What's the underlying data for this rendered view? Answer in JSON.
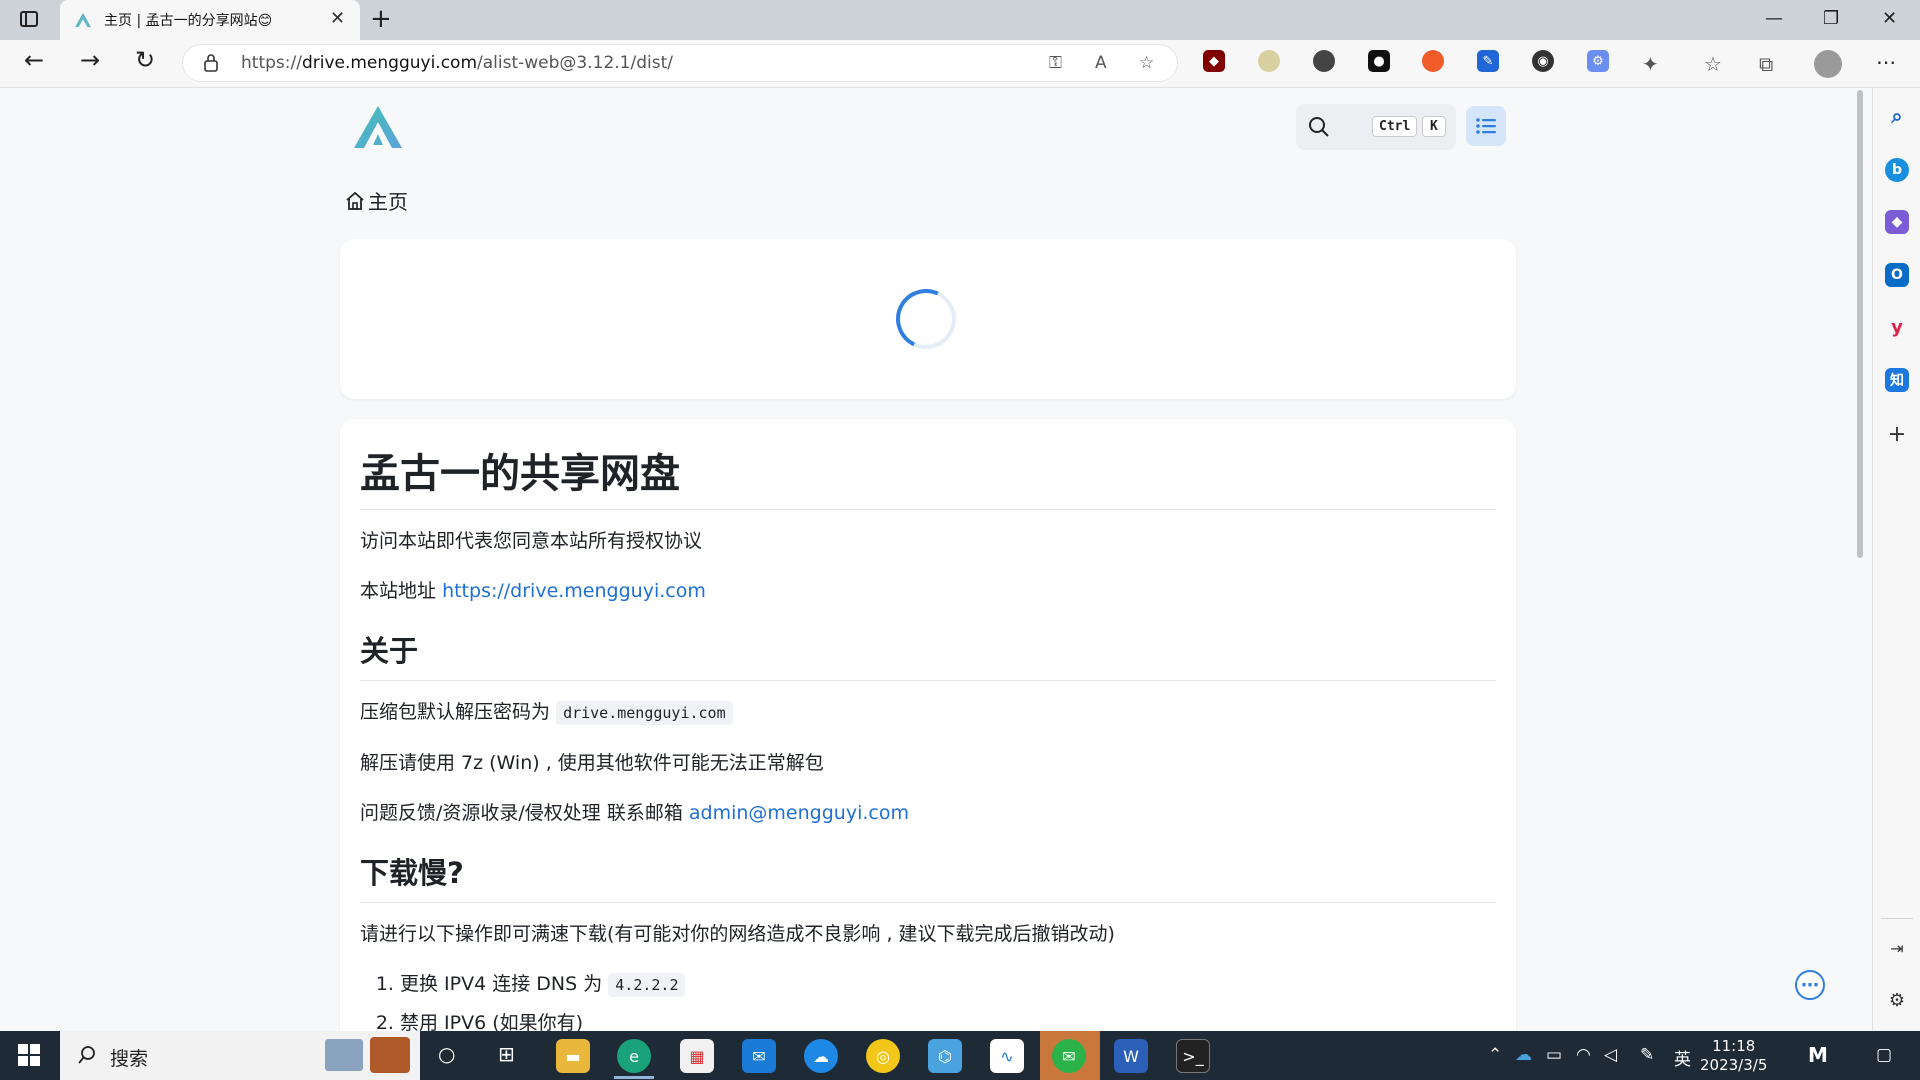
{
  "browser": {
    "tab_title": "主页 | 孟古一的分享网站😊",
    "tab_close": "✕",
    "new_tab": "+",
    "url_prefix": "https://",
    "url_domain": "drive.mengguyi.com",
    "url_path": "/alist-web@3.12.1/dist/",
    "window_controls": {
      "minimize": "—",
      "maximize": "❐",
      "close": "✕"
    },
    "nav": {
      "back": "←",
      "forward": "→",
      "refresh": "↻"
    }
  },
  "site": {
    "breadcrumb_home": "主页",
    "search_shortcut_ctrl": "Ctrl",
    "search_shortcut_key": "K"
  },
  "readme": {
    "title": "孟古一的共享网盘",
    "intro": "访问本站即代表您同意本站所有授权协议",
    "address_label": "本站地址",
    "address_link": "https://drive.mengguyi.com",
    "about_heading": "关于",
    "password_text": "压缩包默认解压密码为",
    "password_code": "drive.mengguyi.com",
    "unzip_text": "解压请使用 7z (Win) , 使用其他软件可能无法正常解包",
    "contact_text": "问题反馈/资源收录/侵权处理 联系邮箱",
    "contact_email": "admin@mengguyi.com",
    "slow_heading": "下载慢?",
    "slow_text": "请进行以下操作即可满速下载(有可能对你的网络造成不良影响 , 建议下载完成后撤销改动)",
    "steps": [
      {
        "text": "更换 IPV4 连接 DNS 为",
        "code": "4.2.2.2"
      },
      {
        "text": "禁用 IPV6 (如果你有)",
        "code": ""
      }
    ]
  },
  "taskbar": {
    "search_label": "搜索",
    "time": "11:18",
    "date": "2023/3/5",
    "ime": "英"
  },
  "colors": {
    "accent": "#2f7ee0",
    "link": "#1f6fd6",
    "taskbar": "#1e2a36"
  }
}
